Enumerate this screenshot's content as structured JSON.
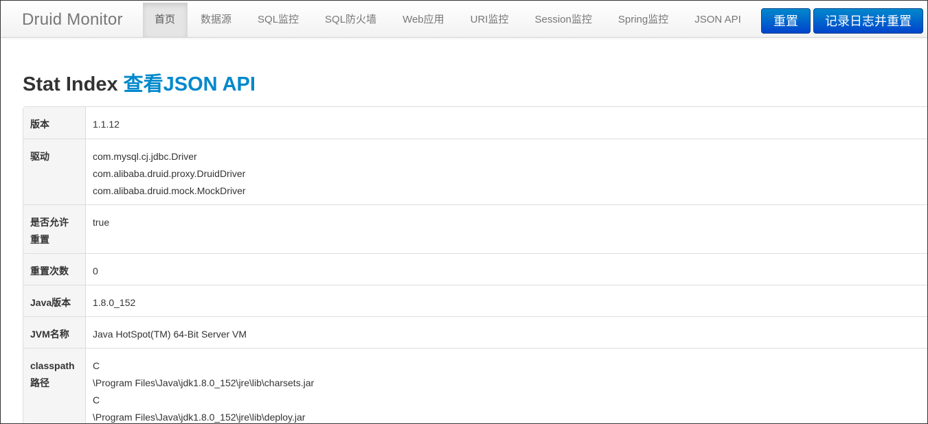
{
  "navbar": {
    "brand": "Druid Monitor",
    "items": [
      {
        "label": "首页",
        "active": true
      },
      {
        "label": "数据源",
        "active": false
      },
      {
        "label": "SQL监控",
        "active": false
      },
      {
        "label": "SQL防火墙",
        "active": false
      },
      {
        "label": "Web应用",
        "active": false
      },
      {
        "label": "URI监控",
        "active": false
      },
      {
        "label": "Session监控",
        "active": false
      },
      {
        "label": "Spring监控",
        "active": false
      },
      {
        "label": "JSON API",
        "active": false
      }
    ],
    "reset_button": "重置",
    "log_reset_button": "记录日志并重置",
    "button_color": "#0074cc"
  },
  "page": {
    "title": "Stat Index",
    "json_link": "查看JSON API",
    "link_color": "#0088cc"
  },
  "stats": {
    "version": {
      "label": "版本",
      "value": "1.1.12"
    },
    "drivers": {
      "label": "驱动",
      "values": [
        "com.mysql.cj.jdbc.Driver",
        "com.alibaba.druid.proxy.DruidDriver",
        "com.alibaba.druid.mock.MockDriver"
      ]
    },
    "reset_enable": {
      "label_line1": "是否允许",
      "label_line2": "重置",
      "value": "true"
    },
    "reset_count": {
      "label": "重置次数",
      "value": "0"
    },
    "java_version": {
      "label": "Java版本",
      "value": "1.8.0_152"
    },
    "jvm_name": {
      "label": "JVM名称",
      "value": "Java HotSpot(TM) 64-Bit Server VM"
    },
    "classpath": {
      "label_line1": "classpath",
      "label_line2": "路径",
      "values": [
        "C",
        "\\Program Files\\Java\\jdk1.8.0_152\\jre\\lib\\charsets.jar",
        "C",
        "\\Program Files\\Java\\jdk1.8.0_152\\jre\\lib\\deploy.jar"
      ]
    }
  }
}
